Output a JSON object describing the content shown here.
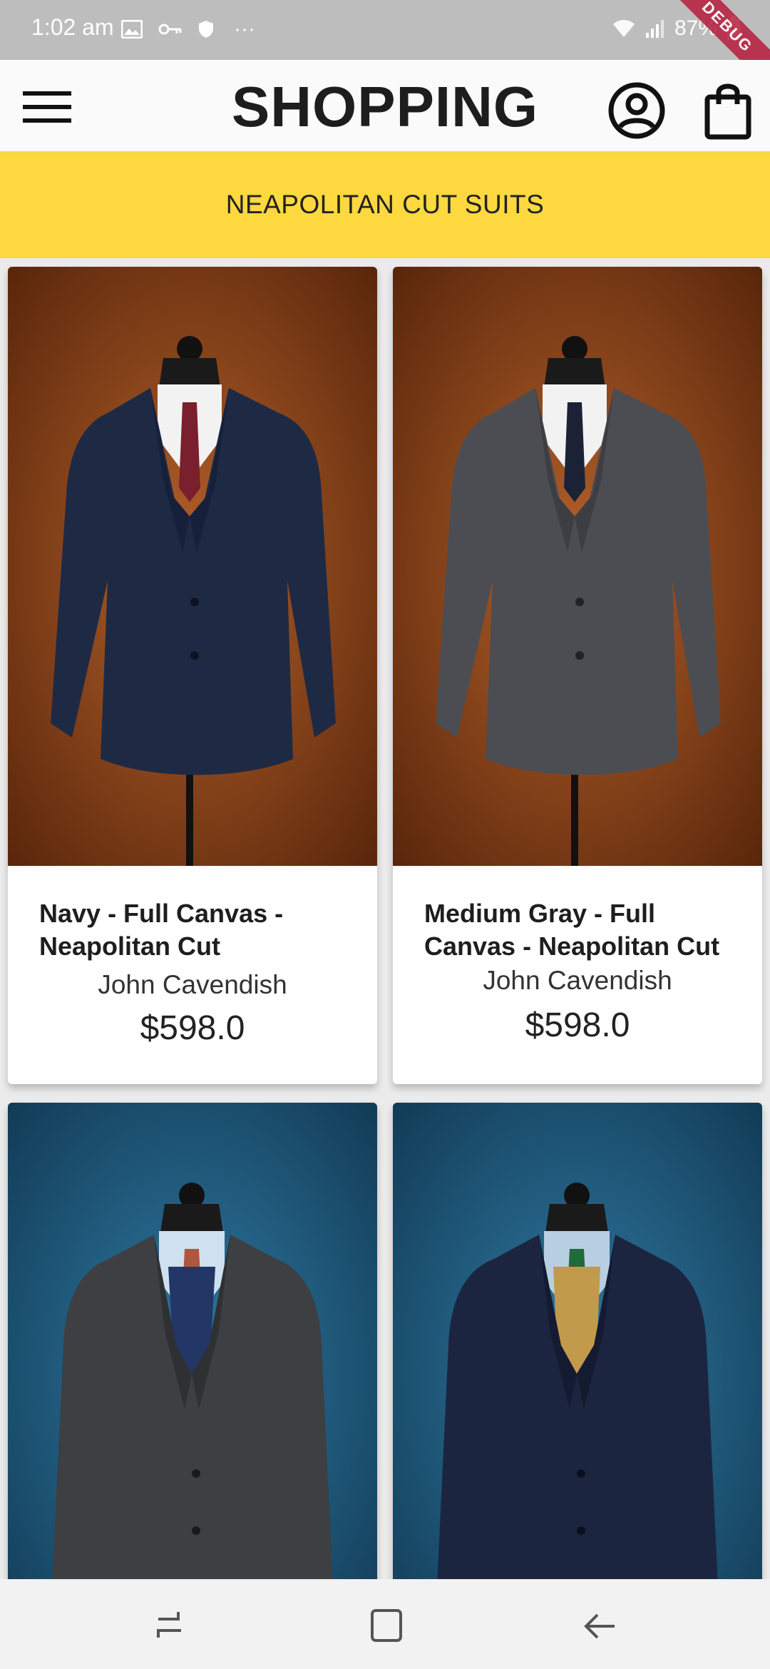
{
  "status_bar": {
    "time": "1:02 am",
    "battery": "87%",
    "debug_label": "DEBUG",
    "more": "···"
  },
  "app_bar": {
    "title": "SHOPPING",
    "menu_icon": "hamburger-menu-icon",
    "account_icon": "account-circle-icon",
    "cart_icon": "shopping-bag-icon"
  },
  "banner": {
    "text": "NEAPOLITAN CUT SUITS"
  },
  "products": [
    {
      "name": "Navy - Full Canvas - Neapolitan Cut",
      "brand": "John Cavendish",
      "price": "$598.0",
      "suit_color": "#1e2a44",
      "tie_color": "#7a1f2e",
      "background": "#9a4a1c"
    },
    {
      "name": "Medium Gray - Full Canvas - Neapolitan Cut",
      "brand": "John Cavendish",
      "price": "$598.0",
      "suit_color": "#4b4d52",
      "tie_color": "#1c2236",
      "background": "#9a4a1c"
    },
    {
      "name": "",
      "brand": "",
      "price": "",
      "suit_color": "#3d3f42",
      "tie_color": "#b0563f",
      "background": "#1d5a7e"
    },
    {
      "name": "",
      "brand": "",
      "price": "",
      "suit_color": "#1c2540",
      "tie_color": "#1f6b3a",
      "background": "#1d5a7e"
    }
  ],
  "colors": {
    "accent_banner": "#fdd83f",
    "status_bar": "#bdbdbd",
    "debug_ribbon": "#b71c3c"
  }
}
